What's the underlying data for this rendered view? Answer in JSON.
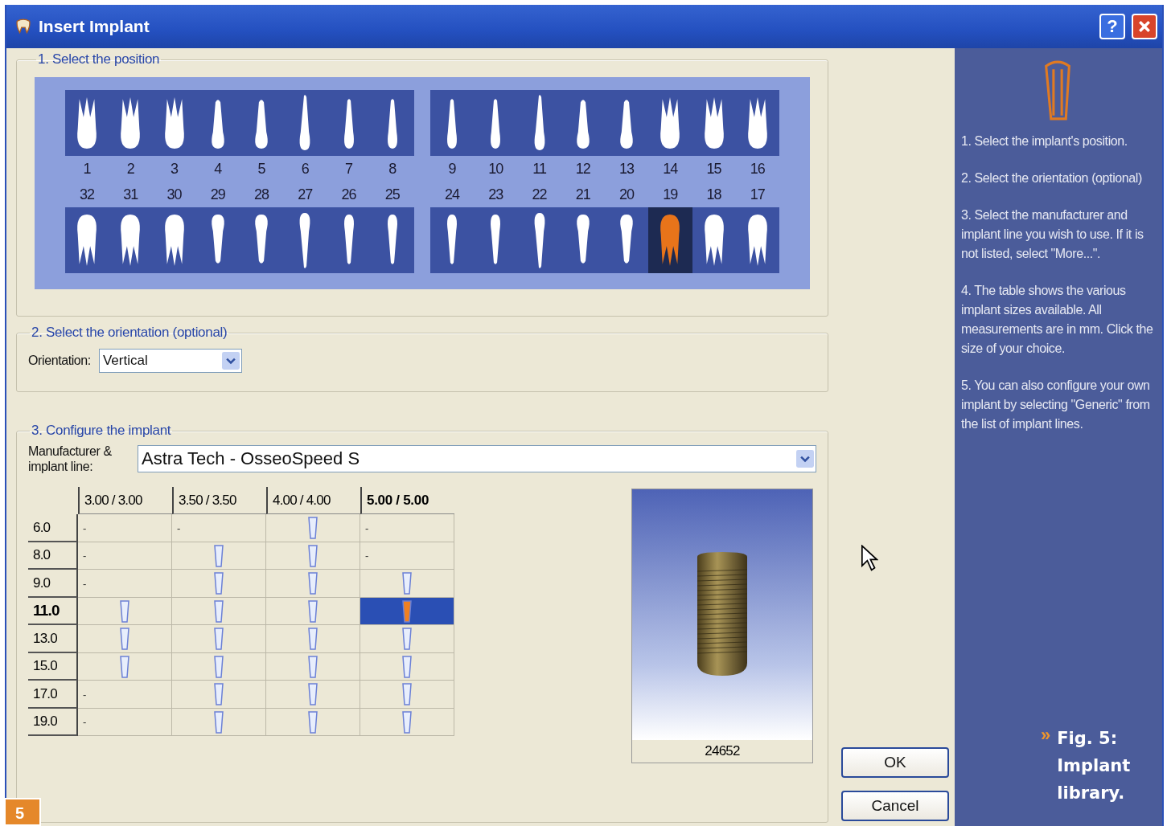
{
  "window": {
    "title": "Insert Implant",
    "help_button": "?"
  },
  "position": {
    "title": "1. Select the position",
    "upper_teeth": [
      {
        "number": "1",
        "kind": "molar",
        "selected": false
      },
      {
        "number": "2",
        "kind": "molar",
        "selected": false
      },
      {
        "number": "3",
        "kind": "molar",
        "selected": false
      },
      {
        "number": "4",
        "kind": "premolar",
        "selected": false
      },
      {
        "number": "5",
        "kind": "premolar",
        "selected": false
      },
      {
        "number": "6",
        "kind": "canine",
        "selected": false
      },
      {
        "number": "7",
        "kind": "incisor",
        "selected": false
      },
      {
        "number": "8",
        "kind": "incisor",
        "selected": false
      },
      {
        "number": "9",
        "kind": "incisor",
        "selected": false
      },
      {
        "number": "10",
        "kind": "incisor",
        "selected": false
      },
      {
        "number": "11",
        "kind": "canine",
        "selected": false
      },
      {
        "number": "12",
        "kind": "premolar",
        "selected": false
      },
      {
        "number": "13",
        "kind": "premolar",
        "selected": false
      },
      {
        "number": "14",
        "kind": "molar",
        "selected": false
      },
      {
        "number": "15",
        "kind": "molar",
        "selected": false
      },
      {
        "number": "16",
        "kind": "molar",
        "selected": false
      }
    ],
    "lower_teeth": [
      {
        "number": "32",
        "kind": "molar",
        "selected": false
      },
      {
        "number": "31",
        "kind": "molar",
        "selected": false
      },
      {
        "number": "30",
        "kind": "molar",
        "selected": false
      },
      {
        "number": "29",
        "kind": "premolar",
        "selected": false
      },
      {
        "number": "28",
        "kind": "premolar",
        "selected": false
      },
      {
        "number": "27",
        "kind": "canine",
        "selected": false
      },
      {
        "number": "26",
        "kind": "incisor",
        "selected": false
      },
      {
        "number": "25",
        "kind": "incisor",
        "selected": false
      },
      {
        "number": "24",
        "kind": "incisor",
        "selected": false
      },
      {
        "number": "23",
        "kind": "incisor",
        "selected": false
      },
      {
        "number": "22",
        "kind": "canine",
        "selected": false
      },
      {
        "number": "21",
        "kind": "premolar",
        "selected": false
      },
      {
        "number": "20",
        "kind": "premolar",
        "selected": false
      },
      {
        "number": "19",
        "kind": "molar",
        "selected": true
      },
      {
        "number": "18",
        "kind": "molar",
        "selected": false
      },
      {
        "number": "17",
        "kind": "molar",
        "selected": false
      }
    ]
  },
  "orientation": {
    "title": "2. Select the orientation (optional)",
    "label": "Orientation:",
    "value": "Vertical"
  },
  "configure": {
    "title": "3. Configure the implant",
    "manufacturer_label": "Manufacturer & implant line:",
    "manufacturer_value": "Astra Tech - OsseoSpeed S",
    "table": {
      "columns": [
        {
          "label": "3.00 / 3.00",
          "selected": false
        },
        {
          "label": "3.50 / 3.50",
          "selected": false
        },
        {
          "label": "4.00 / 4.00",
          "selected": false
        },
        {
          "label": "5.00 / 5.00",
          "selected": true
        }
      ],
      "rows": [
        {
          "length": "6.0",
          "selected": false,
          "cells": [
            {
              "kind": "dash",
              "text": "-"
            },
            {
              "kind": "dash",
              "text": "-"
            },
            {
              "kind": "implant",
              "selected": false
            },
            {
              "kind": "dash",
              "text": "-"
            }
          ]
        },
        {
          "length": "8.0",
          "selected": false,
          "cells": [
            {
              "kind": "dash",
              "text": "-"
            },
            {
              "kind": "implant",
              "selected": false
            },
            {
              "kind": "implant",
              "selected": false
            },
            {
              "kind": "dash",
              "text": "-"
            }
          ]
        },
        {
          "length": "9.0",
          "selected": false,
          "cells": [
            {
              "kind": "dash",
              "text": "-"
            },
            {
              "kind": "implant",
              "selected": false
            },
            {
              "kind": "implant",
              "selected": false
            },
            {
              "kind": "implant",
              "selected": false
            }
          ]
        },
        {
          "length": "11.0",
          "selected": true,
          "cells": [
            {
              "kind": "implant",
              "selected": false
            },
            {
              "kind": "implant",
              "selected": false
            },
            {
              "kind": "implant",
              "selected": false
            },
            {
              "kind": "implant",
              "selected": true
            }
          ]
        },
        {
          "length": "13.0",
          "selected": false,
          "cells": [
            {
              "kind": "implant",
              "selected": false
            },
            {
              "kind": "implant",
              "selected": false
            },
            {
              "kind": "implant",
              "selected": false
            },
            {
              "kind": "implant",
              "selected": false
            }
          ]
        },
        {
          "length": "15.0",
          "selected": false,
          "cells": [
            {
              "kind": "implant",
              "selected": false
            },
            {
              "kind": "implant",
              "selected": false
            },
            {
              "kind": "implant",
              "selected": false
            },
            {
              "kind": "implant",
              "selected": false
            }
          ]
        },
        {
          "length": "17.0",
          "selected": false,
          "cells": [
            {
              "kind": "dash",
              "text": "-"
            },
            {
              "kind": "implant",
              "selected": false
            },
            {
              "kind": "implant",
              "selected": false
            },
            {
              "kind": "implant",
              "selected": false
            }
          ]
        },
        {
          "length": "19.0",
          "selected": false,
          "cells": [
            {
              "kind": "dash",
              "text": "-"
            },
            {
              "kind": "implant",
              "selected": false
            },
            {
              "kind": "implant",
              "selected": false
            },
            {
              "kind": "implant",
              "selected": false
            }
          ]
        }
      ]
    },
    "preview_code": "24652"
  },
  "buttons": [
    "OK",
    "Cancel"
  ],
  "help": [
    "1. Select the implant's position.",
    "2. Select the orientation (optional)",
    "3. Select the manufacturer and implant line you wish to use. If it is not listed, select \"More...\".",
    "4. The table shows the various implant sizes available. All measurements are in mm. Click the size of your choice.",
    "5. You can also configure your own implant by selecting \"Generic\" from the list of implant lines."
  ],
  "figure_caption": {
    "marker": "»",
    "text": "Fig. 5: Implant library."
  },
  "figure_number": "5"
}
